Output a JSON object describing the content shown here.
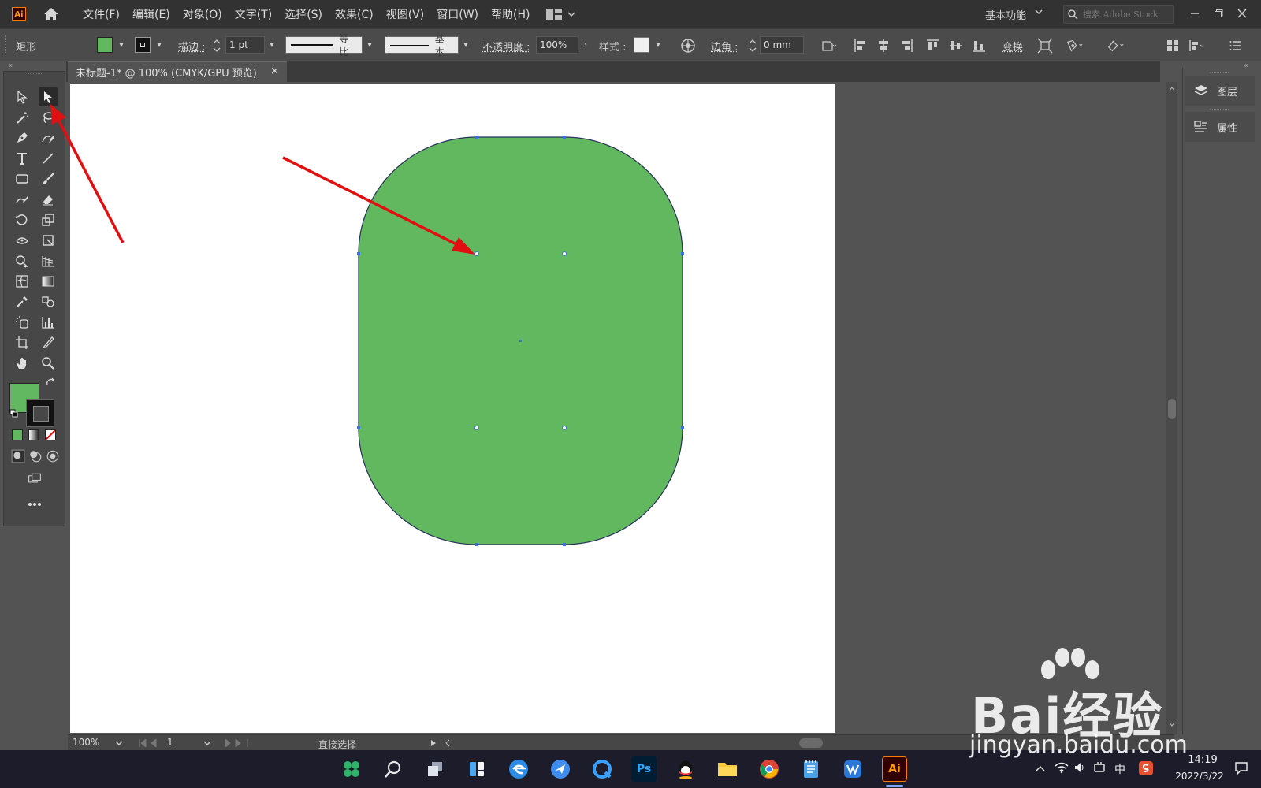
{
  "app": {
    "logo_text": "Ai"
  },
  "menu": [
    "文件(F)",
    "编辑(E)",
    "对象(O)",
    "文字(T)",
    "选择(S)",
    "效果(C)",
    "视图(V)",
    "窗口(W)",
    "帮助(H)"
  ],
  "workspace": {
    "name": "基本功能"
  },
  "search": {
    "placeholder": "搜索 Adobe Stock"
  },
  "control": {
    "object_type": "矩形",
    "fill_color": "#61b861",
    "stroke_label": "描边 :",
    "stroke_weight": "1 pt",
    "stroke_profile": "等比",
    "brush_label": "基本",
    "opacity_label": "不透明度 :",
    "opacity_value": "100%",
    "style_label": "样式 :",
    "corner_label": "边角 :",
    "corner_value": "0 mm",
    "transform_label": "变换"
  },
  "document": {
    "tab_title": "未标题-1* @ 100% (CMYK/GPU 预览)",
    "close_glyph": "×"
  },
  "shape": {
    "fill": "#62b85f",
    "stroke": "#27305a"
  },
  "annotations": {
    "arrow_color": "#e01010"
  },
  "right_panel": {
    "items": [
      {
        "label": "图层",
        "icon": "layers-icon"
      },
      {
        "label": "属性",
        "icon": "properties-icon"
      }
    ]
  },
  "status": {
    "zoom": "100%",
    "artboard_index": "1",
    "tool_name": "直接选择"
  },
  "taskbar": {
    "apps": [
      "start",
      "search",
      "task-view",
      "widgets",
      "edge",
      "feishu",
      "q-browser",
      "photoshop",
      "qq",
      "file-explorer",
      "chrome",
      "notepad",
      "wps",
      "illustrator"
    ],
    "ps_label": "Ps",
    "ai_label": "Ai",
    "ime": "中",
    "time": "14:19",
    "date": "2022/3/22"
  },
  "watermark": {
    "main": "Bai经验",
    "url": "jingyan.baidu.com"
  }
}
